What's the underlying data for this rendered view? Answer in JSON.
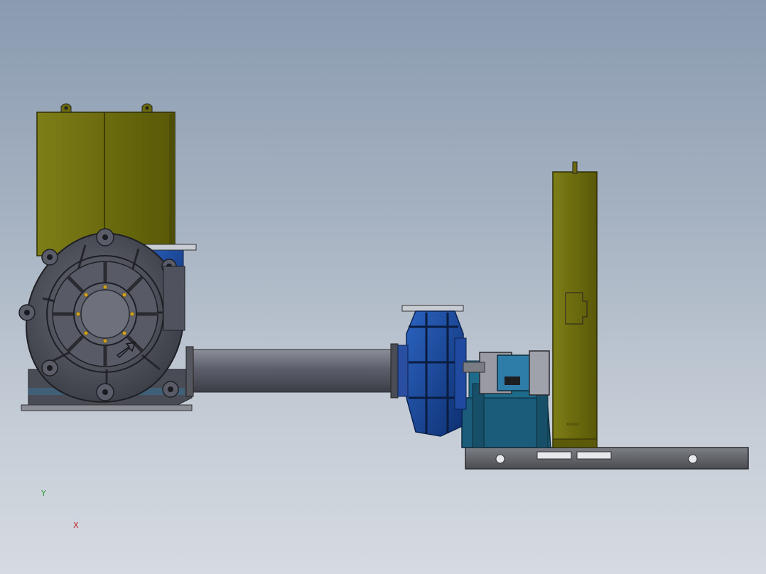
{
  "view": {
    "type": "cad-model-viewport",
    "background_top": "#8a9bb0",
    "background_bottom": "#d6dbe1"
  },
  "assembly": {
    "components": [
      {
        "name": "left-slurry-pump",
        "color": "#4a4d57"
      },
      {
        "name": "left-belt-guard",
        "color": "#6f6f10"
      },
      {
        "name": "connecting-pipe",
        "color": "#5c5f6b"
      },
      {
        "name": "right-slurry-pump",
        "color": "#143f8c"
      },
      {
        "name": "bearing-frame",
        "color": "#1a5c7a"
      },
      {
        "name": "coupling",
        "color": "#9a9aa4"
      },
      {
        "name": "right-belt-guard",
        "color": "#6f6f10"
      },
      {
        "name": "motor",
        "color": "#1b5b7e"
      },
      {
        "name": "motor-stand",
        "color": "#1b6283"
      },
      {
        "name": "base-rail",
        "color": "#5f6168"
      }
    ],
    "nameplate_text": "XXXXXX"
  },
  "triad": {
    "x_label": "X",
    "y_label": "Y",
    "x_color": "#c0222a",
    "y_color": "#2f9a3a",
    "z_color": "#1c3f9e"
  }
}
